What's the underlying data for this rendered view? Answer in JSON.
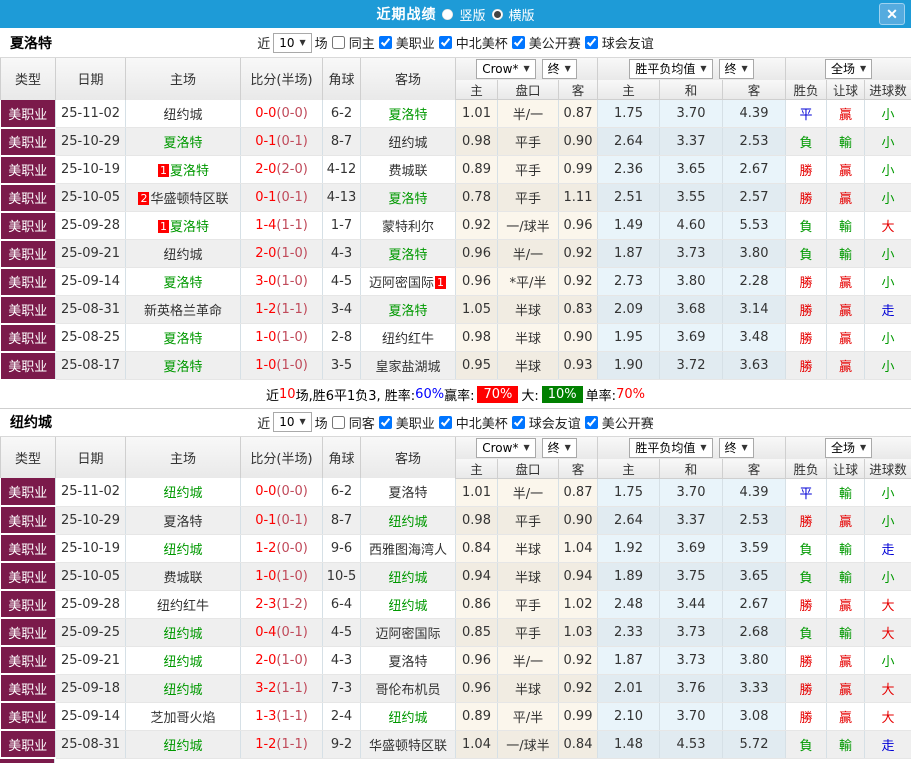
{
  "titlebar": {
    "title": "近期战绩",
    "radio_vertical": "竖版",
    "radio_horizontal": "横版",
    "close_label": "✕"
  },
  "table_header": {
    "type": "类型",
    "date": "日期",
    "home": "主场",
    "score": "比分(半场)",
    "corner": "角球",
    "away": "客场",
    "odds_select": "Crow*",
    "odds_final": "终",
    "avg_select": "胜平负均值",
    "avg_final": "终",
    "scope_select": "全场",
    "sub": [
      "主",
      "盘口",
      "客",
      "主",
      "和",
      "客",
      "胜负",
      "让球",
      "进球数"
    ]
  },
  "sections": [
    {
      "team": "夏洛特",
      "filter": {
        "prefix": "近",
        "count": "10",
        "suffix": "场",
        "same": {
          "label": "同主",
          "checked": false
        },
        "leagues": [
          {
            "label": "美职业",
            "checked": true
          },
          {
            "label": "中北美杯",
            "checked": true
          },
          {
            "label": "美公开赛",
            "checked": true
          },
          {
            "label": "球会友谊",
            "checked": true
          }
        ]
      },
      "rows": [
        {
          "lg": "美职业",
          "date": "25-11-02",
          "home": "纽约城",
          "hcls": "",
          "hb": "",
          "sc": "0-0",
          "hf": "(0-0)",
          "cn": "6-2",
          "away": "夏洛特",
          "acls": "g",
          "ab": "",
          "o1": "1.01",
          "pan": "半/一",
          "o2": "0.87",
          "a1": "1.75",
          "a2": "3.70",
          "a3": "4.39",
          "r1": [
            "平",
            "b"
          ],
          "r2": [
            "贏",
            "r"
          ],
          "r3": [
            "小",
            "g"
          ]
        },
        {
          "lg": "美职业",
          "date": "25-10-29",
          "home": "夏洛特",
          "hcls": "g",
          "hb": "",
          "sc": "0-1",
          "hf": "(0-1)",
          "cn": "8-7",
          "away": "纽约城",
          "acls": "",
          "ab": "",
          "o1": "0.98",
          "pan": "平手",
          "o2": "0.90",
          "a1": "2.64",
          "a2": "3.37",
          "a3": "2.53",
          "r1": [
            "負",
            "g"
          ],
          "r2": [
            "輸",
            "g"
          ],
          "r3": [
            "小",
            "g"
          ]
        },
        {
          "lg": "美职业",
          "date": "25-10-19",
          "home": "夏洛特",
          "hcls": "g",
          "hb": "1",
          "sc": "2-0",
          "hf": "(2-0)",
          "cn": "4-12",
          "away": "费城联",
          "acls": "",
          "ab": "",
          "o1": "0.89",
          "pan": "平手",
          "o2": "0.99",
          "a1": "2.36",
          "a2": "3.65",
          "a3": "2.67",
          "r1": [
            "勝",
            "r"
          ],
          "r2": [
            "贏",
            "r"
          ],
          "r3": [
            "小",
            "g"
          ]
        },
        {
          "lg": "美职业",
          "date": "25-10-05",
          "home": "华盛顿特区联",
          "hcls": "",
          "hb": "2",
          "sc": "0-1",
          "hf": "(0-1)",
          "cn": "4-13",
          "away": "夏洛特",
          "acls": "g",
          "ab": "",
          "o1": "0.78",
          "pan": "平手",
          "o2": "1.11",
          "a1": "2.51",
          "a2": "3.55",
          "a3": "2.57",
          "r1": [
            "勝",
            "r"
          ],
          "r2": [
            "贏",
            "r"
          ],
          "r3": [
            "小",
            "g"
          ]
        },
        {
          "lg": "美职业",
          "date": "25-09-28",
          "home": "夏洛特",
          "hcls": "g",
          "hb": "1",
          "sc": "1-4",
          "hf": "(1-1)",
          "cn": "1-7",
          "away": "蒙特利尔",
          "acls": "",
          "ab": "",
          "o1": "0.92",
          "pan": "一/球半",
          "o2": "0.96",
          "a1": "1.49",
          "a2": "4.60",
          "a3": "5.53",
          "r1": [
            "負",
            "g"
          ],
          "r2": [
            "輸",
            "g"
          ],
          "r3": [
            "大",
            "r"
          ]
        },
        {
          "lg": "美职业",
          "date": "25-09-21",
          "home": "纽约城",
          "hcls": "",
          "hb": "",
          "sc": "2-0",
          "hf": "(1-0)",
          "cn": "4-3",
          "away": "夏洛特",
          "acls": "g",
          "ab": "",
          "o1": "0.96",
          "pan": "半/一",
          "o2": "0.92",
          "a1": "1.87",
          "a2": "3.73",
          "a3": "3.80",
          "r1": [
            "負",
            "g"
          ],
          "r2": [
            "輸",
            "g"
          ],
          "r3": [
            "小",
            "g"
          ]
        },
        {
          "lg": "美职业",
          "date": "25-09-14",
          "home": "夏洛特",
          "hcls": "g",
          "hb": "",
          "sc": "3-0",
          "hf": "(1-0)",
          "cn": "4-5",
          "away": "迈阿密国际",
          "acls": "",
          "ab": "1",
          "o1": "0.96",
          "pan": "*平/半",
          "o2": "0.92",
          "a1": "2.73",
          "a2": "3.80",
          "a3": "2.28",
          "r1": [
            "勝",
            "r"
          ],
          "r2": [
            "贏",
            "r"
          ],
          "r3": [
            "小",
            "g"
          ]
        },
        {
          "lg": "美职业",
          "date": "25-08-31",
          "home": "新英格兰革命",
          "hcls": "",
          "hb": "",
          "sc": "1-2",
          "hf": "(1-1)",
          "cn": "3-4",
          "away": "夏洛特",
          "acls": "g",
          "ab": "",
          "o1": "1.05",
          "pan": "半球",
          "o2": "0.83",
          "a1": "2.09",
          "a2": "3.68",
          "a3": "3.14",
          "r1": [
            "勝",
            "r"
          ],
          "r2": [
            "贏",
            "r"
          ],
          "r3": [
            "走",
            "b"
          ]
        },
        {
          "lg": "美职业",
          "date": "25-08-25",
          "home": "夏洛特",
          "hcls": "g",
          "hb": "",
          "sc": "1-0",
          "hf": "(1-0)",
          "cn": "2-8",
          "away": "纽约红牛",
          "acls": "",
          "ab": "",
          "o1": "0.98",
          "pan": "半球",
          "o2": "0.90",
          "a1": "1.95",
          "a2": "3.69",
          "a3": "3.48",
          "r1": [
            "勝",
            "r"
          ],
          "r2": [
            "贏",
            "r"
          ],
          "r3": [
            "小",
            "g"
          ]
        },
        {
          "lg": "美职业",
          "date": "25-08-17",
          "home": "夏洛特",
          "hcls": "g",
          "hb": "",
          "sc": "1-0",
          "hf": "(1-0)",
          "cn": "3-5",
          "away": "皇家盐湖城",
          "acls": "",
          "ab": "",
          "o1": "0.95",
          "pan": "半球",
          "o2": "0.93",
          "a1": "1.90",
          "a2": "3.72",
          "a3": "3.63",
          "r1": [
            "勝",
            "r"
          ],
          "r2": [
            "贏",
            "r"
          ],
          "r3": [
            "小",
            "g"
          ]
        }
      ],
      "summary_parts": [
        {
          "text": "近"
        },
        {
          "text": "10",
          "color": "red"
        },
        {
          "text": "场,胜6平1负3, 胜率:"
        },
        {
          "text": "60%",
          "color": "blue"
        },
        {
          "text": " 赢率:"
        },
        {
          "text": "70%",
          "bg": "red"
        },
        {
          "text": " 大:"
        },
        {
          "text": "10%",
          "bg": "green"
        },
        {
          "text": " 单率:"
        },
        {
          "text": "70%",
          "color": "red"
        }
      ],
      "partial_row": false
    },
    {
      "team": "纽约城",
      "filter": {
        "prefix": "近",
        "count": "10",
        "suffix": "场",
        "same": {
          "label": "同客",
          "checked": false
        },
        "leagues": [
          {
            "label": "美职业",
            "checked": true
          },
          {
            "label": "中北美杯",
            "checked": true
          },
          {
            "label": "球会友谊",
            "checked": true
          },
          {
            "label": "美公开赛",
            "checked": true
          }
        ]
      },
      "rows": [
        {
          "lg": "美职业",
          "date": "25-11-02",
          "home": "纽约城",
          "hcls": "g",
          "hb": "",
          "sc": "0-0",
          "hf": "(0-0)",
          "cn": "6-2",
          "away": "夏洛特",
          "acls": "",
          "ab": "",
          "o1": "1.01",
          "pan": "半/一",
          "o2": "0.87",
          "a1": "1.75",
          "a2": "3.70",
          "a3": "4.39",
          "r1": [
            "平",
            "b"
          ],
          "r2": [
            "輸",
            "g"
          ],
          "r3": [
            "小",
            "g"
          ]
        },
        {
          "lg": "美职业",
          "date": "25-10-29",
          "home": "夏洛特",
          "hcls": "",
          "hb": "",
          "sc": "0-1",
          "hf": "(0-1)",
          "cn": "8-7",
          "away": "纽约城",
          "acls": "g",
          "ab": "",
          "o1": "0.98",
          "pan": "平手",
          "o2": "0.90",
          "a1": "2.64",
          "a2": "3.37",
          "a3": "2.53",
          "r1": [
            "勝",
            "r"
          ],
          "r2": [
            "贏",
            "r"
          ],
          "r3": [
            "小",
            "g"
          ]
        },
        {
          "lg": "美职业",
          "date": "25-10-19",
          "home": "纽约城",
          "hcls": "g",
          "hb": "",
          "sc": "1-2",
          "hf": "(0-0)",
          "cn": "9-6",
          "away": "西雅图海湾人",
          "acls": "",
          "ab": "",
          "o1": "0.84",
          "pan": "半球",
          "o2": "1.04",
          "a1": "1.92",
          "a2": "3.69",
          "a3": "3.59",
          "r1": [
            "負",
            "g"
          ],
          "r2": [
            "輸",
            "g"
          ],
          "r3": [
            "走",
            "b"
          ]
        },
        {
          "lg": "美职业",
          "date": "25-10-05",
          "home": "费城联",
          "hcls": "",
          "hb": "",
          "sc": "1-0",
          "hf": "(1-0)",
          "cn": "10-5",
          "away": "纽约城",
          "acls": "g",
          "ab": "",
          "o1": "0.94",
          "pan": "半球",
          "o2": "0.94",
          "a1": "1.89",
          "a2": "3.75",
          "a3": "3.65",
          "r1": [
            "負",
            "g"
          ],
          "r2": [
            "輸",
            "g"
          ],
          "r3": [
            "小",
            "g"
          ]
        },
        {
          "lg": "美职业",
          "date": "25-09-28",
          "home": "纽约红牛",
          "hcls": "",
          "hb": "",
          "sc": "2-3",
          "hf": "(1-2)",
          "cn": "6-4",
          "away": "纽约城",
          "acls": "g",
          "ab": "",
          "o1": "0.86",
          "pan": "平手",
          "o2": "1.02",
          "a1": "2.48",
          "a2": "3.44",
          "a3": "2.67",
          "r1": [
            "勝",
            "r"
          ],
          "r2": [
            "贏",
            "r"
          ],
          "r3": [
            "大",
            "r"
          ]
        },
        {
          "lg": "美职业",
          "date": "25-09-25",
          "home": "纽约城",
          "hcls": "g",
          "hb": "",
          "sc": "0-4",
          "hf": "(0-1)",
          "cn": "4-5",
          "away": "迈阿密国际",
          "acls": "",
          "ab": "",
          "o1": "0.85",
          "pan": "平手",
          "o2": "1.03",
          "a1": "2.33",
          "a2": "3.73",
          "a3": "2.68",
          "r1": [
            "負",
            "g"
          ],
          "r2": [
            "輸",
            "g"
          ],
          "r3": [
            "大",
            "r"
          ]
        },
        {
          "lg": "美职业",
          "date": "25-09-21",
          "home": "纽约城",
          "hcls": "g",
          "hb": "",
          "sc": "2-0",
          "hf": "(1-0)",
          "cn": "4-3",
          "away": "夏洛特",
          "acls": "",
          "ab": "",
          "o1": "0.96",
          "pan": "半/一",
          "o2": "0.92",
          "a1": "1.87",
          "a2": "3.73",
          "a3": "3.80",
          "r1": [
            "勝",
            "r"
          ],
          "r2": [
            "贏",
            "r"
          ],
          "r3": [
            "小",
            "g"
          ]
        },
        {
          "lg": "美职业",
          "date": "25-09-18",
          "home": "纽约城",
          "hcls": "g",
          "hb": "",
          "sc": "3-2",
          "hf": "(1-1)",
          "cn": "7-3",
          "away": "哥伦布机员",
          "acls": "",
          "ab": "",
          "o1": "0.96",
          "pan": "半球",
          "o2": "0.92",
          "a1": "2.01",
          "a2": "3.76",
          "a3": "3.33",
          "r1": [
            "勝",
            "r"
          ],
          "r2": [
            "贏",
            "r"
          ],
          "r3": [
            "大",
            "r"
          ]
        },
        {
          "lg": "美职业",
          "date": "25-09-14",
          "home": "芝加哥火焰",
          "hcls": "",
          "hb": "",
          "sc": "1-3",
          "hf": "(1-1)",
          "cn": "2-4",
          "away": "纽约城",
          "acls": "g",
          "ab": "",
          "o1": "0.89",
          "pan": "平/半",
          "o2": "0.99",
          "a1": "2.10",
          "a2": "3.70",
          "a3": "3.08",
          "r1": [
            "勝",
            "r"
          ],
          "r2": [
            "贏",
            "r"
          ],
          "r3": [
            "大",
            "r"
          ]
        },
        {
          "lg": "美职业",
          "date": "25-08-31",
          "home": "纽约城",
          "hcls": "g",
          "hb": "",
          "sc": "1-2",
          "hf": "(1-1)",
          "cn": "9-2",
          "away": "华盛顿特区联",
          "acls": "",
          "ab": "",
          "o1": "1.04",
          "pan": "一/球半",
          "o2": "0.84",
          "a1": "1.48",
          "a2": "4.53",
          "a3": "5.72",
          "r1": [
            "負",
            "g"
          ],
          "r2": [
            "輸",
            "g"
          ],
          "r3": [
            "走",
            "b"
          ]
        }
      ],
      "summary_parts": [],
      "partial_row": true
    }
  ]
}
